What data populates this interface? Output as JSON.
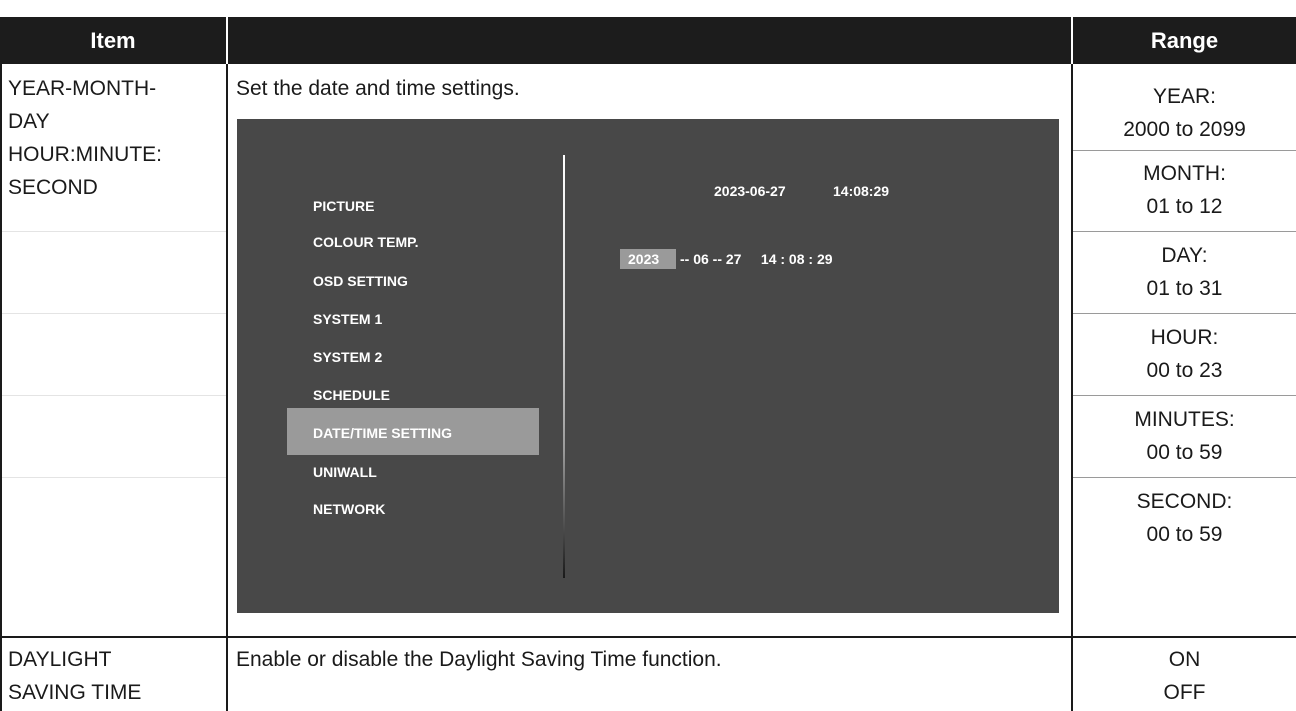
{
  "header": {
    "item": "Item",
    "description": "",
    "range": "Range"
  },
  "row1": {
    "item_lines": [
      "YEAR-MONTH-",
      "DAY",
      "HOUR:MINUTE:",
      "SECOND"
    ],
    "description": "Set the date and time settings.",
    "ranges": [
      {
        "label": "YEAR:",
        "value": "2000 to 2099"
      },
      {
        "label": "MONTH:",
        "value": "01 to 12"
      },
      {
        "label": "DAY:",
        "value": "01 to 31"
      },
      {
        "label": "HOUR:",
        "value": "00 to 23"
      },
      {
        "label": "MINUTES:",
        "value": "00 to 59"
      },
      {
        "label": "SECOND:",
        "value": "00 to 59"
      }
    ]
  },
  "osd": {
    "menu": [
      "PICTURE",
      "COLOUR TEMP.",
      "OSD SETTING",
      "SYSTEM 1",
      "SYSTEM 2",
      "SCHEDULE",
      "DATE/TIME SETTING",
      "UNIWALL",
      "NETWORK"
    ],
    "selected_index": 6,
    "current_date": "2023-06-27",
    "current_time": "14:08:29",
    "edit_year": "2023",
    "edit_rest": "-- 06 -- 27     14 : 08 : 29"
  },
  "row2": {
    "item_lines": [
      "DAYLIGHT",
      "SAVING TIME"
    ],
    "description": "Enable or disable the Daylight Saving Time function.",
    "ranges": [
      "ON",
      "OFF"
    ]
  },
  "colors": {
    "header_bg": "#1c1c1c",
    "osd_bg": "#484848",
    "selection": "#9a9a9a"
  }
}
